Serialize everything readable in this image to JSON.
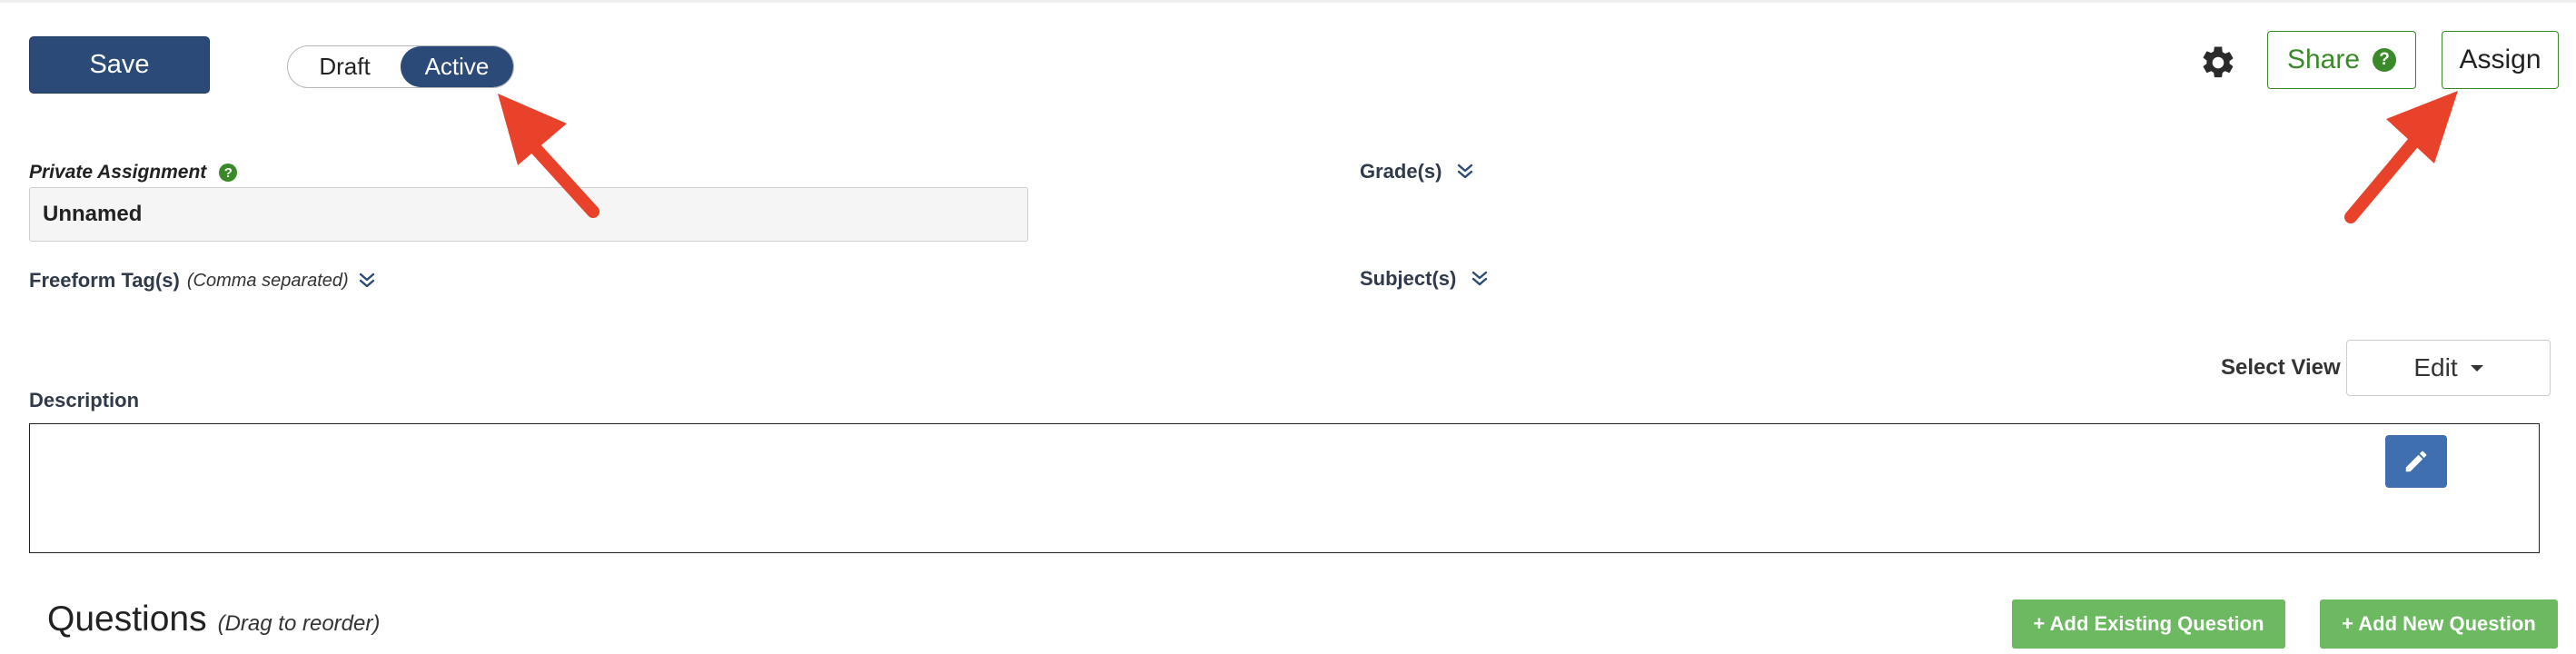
{
  "toolbar": {
    "save_label": "Save",
    "status_toggle": {
      "draft_label": "Draft",
      "active_label": "Active",
      "selected": "Active"
    },
    "share_label": "Share",
    "share_help_glyph": "?",
    "assign_label": "Assign"
  },
  "form": {
    "private_assignment_label": "Private Assignment",
    "private_help_glyph": "?",
    "name_value": "Unnamed",
    "freeform_tags_label": "Freeform Tag(s)",
    "freeform_tags_note": "(Comma separated)",
    "grades_label": "Grade(s)",
    "subjects_label": "Subject(s)",
    "select_view_label": "Select View",
    "view_value": "Edit",
    "description_label": "Description",
    "description_value": ""
  },
  "questions": {
    "title": "Questions",
    "hint": "(Drag to reorder)",
    "add_existing_label": "+ Add Existing Question",
    "add_new_label": "+ Add New Question"
  },
  "icons": {
    "settings": "gear-icon",
    "help": "question-circle-icon",
    "expand": "double-chevron-down-icon",
    "edit": "pencil-icon",
    "annotation": "red-arrow"
  },
  "colors": {
    "primary": "#2b4a77",
    "success": "#3a8a2a",
    "add_button": "#6cb961",
    "edit_button": "#3f6fae",
    "annotation_arrow": "#e8422b"
  }
}
